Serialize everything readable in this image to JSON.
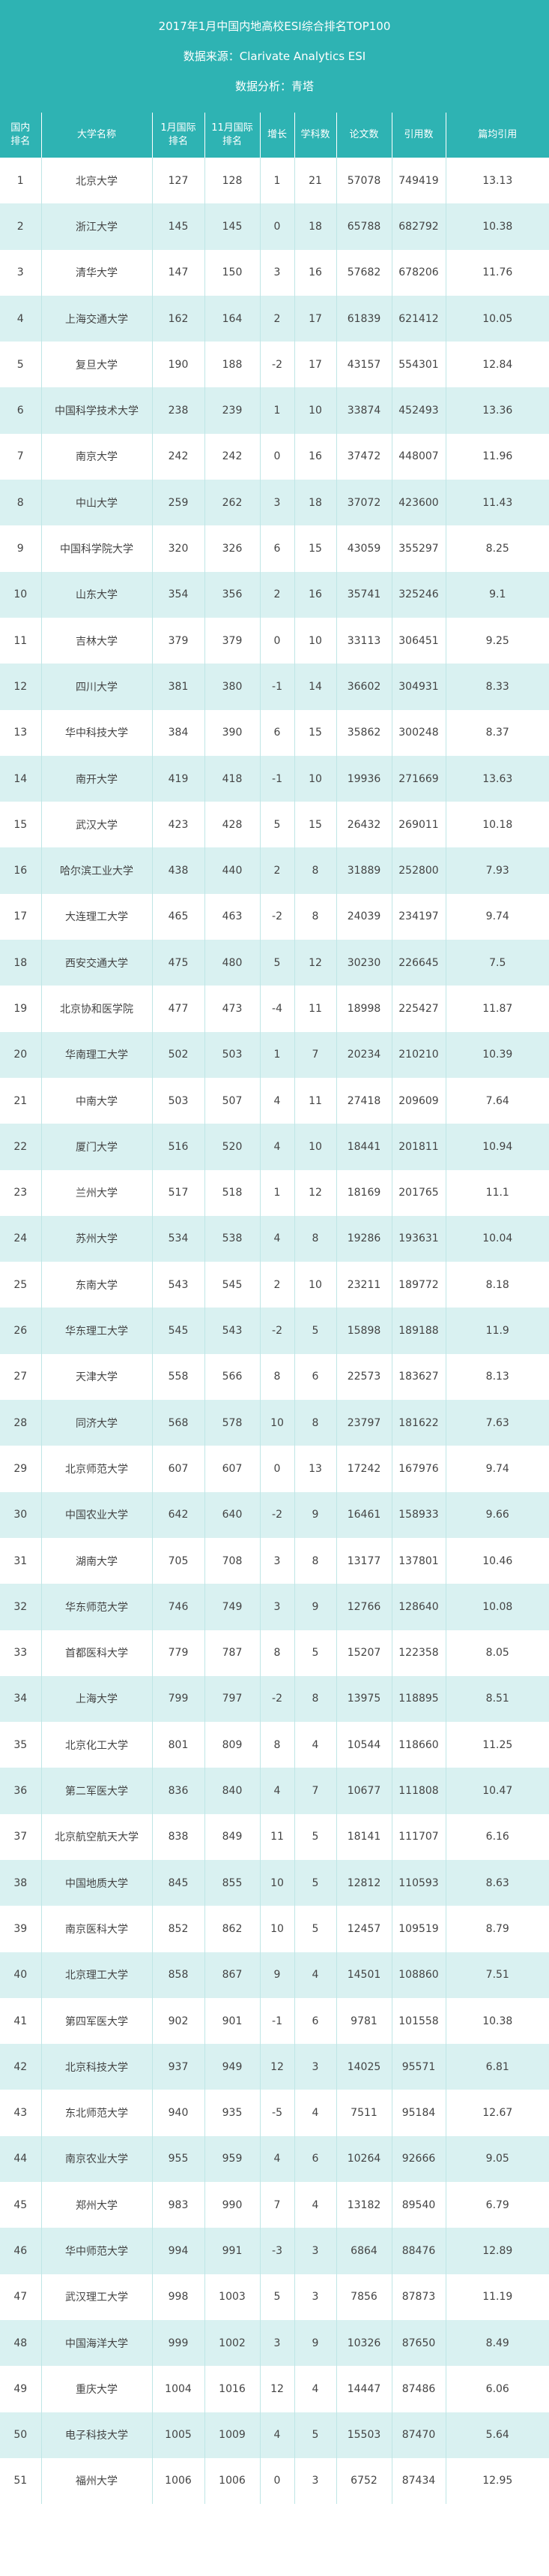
{
  "header": {
    "title": "2017年1月中国内地高校ESI综合排名TOP100",
    "source": "数据来源：Clarivate Analytics ESI",
    "analysis": "数据分析：青塔"
  },
  "columns": [
    "国内\n排名",
    "大学名称",
    "1月国际\n排名",
    "11月国际\n排名",
    "增长",
    "学科数",
    "论文数",
    "引用数",
    "篇均引用"
  ],
  "rows": [
    [
      "1",
      "北京大学",
      "127",
      "128",
      "1",
      "21",
      "57078",
      "749419",
      "13.13"
    ],
    [
      "2",
      "浙江大学",
      "145",
      "145",
      "0",
      "18",
      "65788",
      "682792",
      "10.38"
    ],
    [
      "3",
      "清华大学",
      "147",
      "150",
      "3",
      "16",
      "57682",
      "678206",
      "11.76"
    ],
    [
      "4",
      "上海交通大学",
      "162",
      "164",
      "2",
      "17",
      "61839",
      "621412",
      "10.05"
    ],
    [
      "5",
      "复旦大学",
      "190",
      "188",
      "-2",
      "17",
      "43157",
      "554301",
      "12.84"
    ],
    [
      "6",
      "中国科学技术大学",
      "238",
      "239",
      "1",
      "10",
      "33874",
      "452493",
      "13.36"
    ],
    [
      "7",
      "南京大学",
      "242",
      "242",
      "0",
      "16",
      "37472",
      "448007",
      "11.96"
    ],
    [
      "8",
      "中山大学",
      "259",
      "262",
      "3",
      "18",
      "37072",
      "423600",
      "11.43"
    ],
    [
      "9",
      "中国科学院大学",
      "320",
      "326",
      "6",
      "15",
      "43059",
      "355297",
      "8.25"
    ],
    [
      "10",
      "山东大学",
      "354",
      "356",
      "2",
      "16",
      "35741",
      "325246",
      "9.1"
    ],
    [
      "11",
      "吉林大学",
      "379",
      "379",
      "0",
      "10",
      "33113",
      "306451",
      "9.25"
    ],
    [
      "12",
      "四川大学",
      "381",
      "380",
      "-1",
      "14",
      "36602",
      "304931",
      "8.33"
    ],
    [
      "13",
      "华中科技大学",
      "384",
      "390",
      "6",
      "15",
      "35862",
      "300248",
      "8.37"
    ],
    [
      "14",
      "南开大学",
      "419",
      "418",
      "-1",
      "10",
      "19936",
      "271669",
      "13.63"
    ],
    [
      "15",
      "武汉大学",
      "423",
      "428",
      "5",
      "15",
      "26432",
      "269011",
      "10.18"
    ],
    [
      "16",
      "哈尔滨工业大学",
      "438",
      "440",
      "2",
      "8",
      "31889",
      "252800",
      "7.93"
    ],
    [
      "17",
      "大连理工大学",
      "465",
      "463",
      "-2",
      "8",
      "24039",
      "234197",
      "9.74"
    ],
    [
      "18",
      "西安交通大学",
      "475",
      "480",
      "5",
      "12",
      "30230",
      "226645",
      "7.5"
    ],
    [
      "19",
      "北京协和医学院",
      "477",
      "473",
      "-4",
      "11",
      "18998",
      "225427",
      "11.87"
    ],
    [
      "20",
      "华南理工大学",
      "502",
      "503",
      "1",
      "7",
      "20234",
      "210210",
      "10.39"
    ],
    [
      "21",
      "中南大学",
      "503",
      "507",
      "4",
      "11",
      "27418",
      "209609",
      "7.64"
    ],
    [
      "22",
      "厦门大学",
      "516",
      "520",
      "4",
      "10",
      "18441",
      "201811",
      "10.94"
    ],
    [
      "23",
      "兰州大学",
      "517",
      "518",
      "1",
      "12",
      "18169",
      "201765",
      "11.1"
    ],
    [
      "24",
      "苏州大学",
      "534",
      "538",
      "4",
      "8",
      "19286",
      "193631",
      "10.04"
    ],
    [
      "25",
      "东南大学",
      "543",
      "545",
      "2",
      "10",
      "23211",
      "189772",
      "8.18"
    ],
    [
      "26",
      "华东理工大学",
      "545",
      "543",
      "-2",
      "5",
      "15898",
      "189188",
      "11.9"
    ],
    [
      "27",
      "天津大学",
      "558",
      "566",
      "8",
      "6",
      "22573",
      "183627",
      "8.13"
    ],
    [
      "28",
      "同济大学",
      "568",
      "578",
      "10",
      "8",
      "23797",
      "181622",
      "7.63"
    ],
    [
      "29",
      "北京师范大学",
      "607",
      "607",
      "0",
      "13",
      "17242",
      "167976",
      "9.74"
    ],
    [
      "30",
      "中国农业大学",
      "642",
      "640",
      "-2",
      "9",
      "16461",
      "158933",
      "9.66"
    ],
    [
      "31",
      "湖南大学",
      "705",
      "708",
      "3",
      "8",
      "13177",
      "137801",
      "10.46"
    ],
    [
      "32",
      "华东师范大学",
      "746",
      "749",
      "3",
      "9",
      "12766",
      "128640",
      "10.08"
    ],
    [
      "33",
      "首都医科大学",
      "779",
      "787",
      "8",
      "5",
      "15207",
      "122358",
      "8.05"
    ],
    [
      "34",
      "上海大学",
      "799",
      "797",
      "-2",
      "8",
      "13975",
      "118895",
      "8.51"
    ],
    [
      "35",
      "北京化工大学",
      "801",
      "809",
      "8",
      "4",
      "10544",
      "118660",
      "11.25"
    ],
    [
      "36",
      "第二军医大学",
      "836",
      "840",
      "4",
      "7",
      "10677",
      "111808",
      "10.47"
    ],
    [
      "37",
      "北京航空航天大学",
      "838",
      "849",
      "11",
      "5",
      "18141",
      "111707",
      "6.16"
    ],
    [
      "38",
      "中国地质大学",
      "845",
      "855",
      "10",
      "5",
      "12812",
      "110593",
      "8.63"
    ],
    [
      "39",
      "南京医科大学",
      "852",
      "862",
      "10",
      "5",
      "12457",
      "109519",
      "8.79"
    ],
    [
      "40",
      "北京理工大学",
      "858",
      "867",
      "9",
      "4",
      "14501",
      "108860",
      "7.51"
    ],
    [
      "41",
      "第四军医大学",
      "902",
      "901",
      "-1",
      "6",
      "9781",
      "101558",
      "10.38"
    ],
    [
      "42",
      "北京科技大学",
      "937",
      "949",
      "12",
      "3",
      "14025",
      "95571",
      "6.81"
    ],
    [
      "43",
      "东北师范大学",
      "940",
      "935",
      "-5",
      "4",
      "7511",
      "95184",
      "12.67"
    ],
    [
      "44",
      "南京农业大学",
      "955",
      "959",
      "4",
      "6",
      "10264",
      "92666",
      "9.05"
    ],
    [
      "45",
      "郑州大学",
      "983",
      "990",
      "7",
      "4",
      "13182",
      "89540",
      "6.79"
    ],
    [
      "46",
      "华中师范大学",
      "994",
      "991",
      "-3",
      "3",
      "6864",
      "88476",
      "12.89"
    ],
    [
      "47",
      "武汉理工大学",
      "998",
      "1003",
      "5",
      "3",
      "7856",
      "87873",
      "11.19"
    ],
    [
      "48",
      "中国海洋大学",
      "999",
      "1002",
      "3",
      "9",
      "10326",
      "87650",
      "8.49"
    ],
    [
      "49",
      "重庆大学",
      "1004",
      "1016",
      "12",
      "4",
      "14447",
      "87486",
      "6.06"
    ],
    [
      "50",
      "电子科技大学",
      "1005",
      "1009",
      "4",
      "5",
      "15503",
      "87470",
      "5.64"
    ],
    [
      "51",
      "福州大学",
      "1006",
      "1006",
      "0",
      "3",
      "6752",
      "87434",
      "12.95"
    ]
  ]
}
